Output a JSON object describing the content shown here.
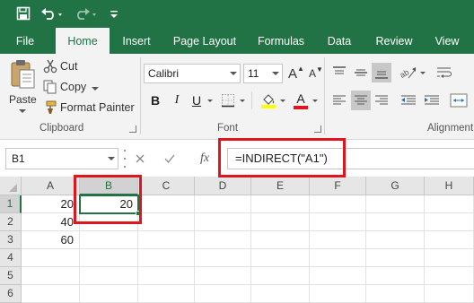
{
  "app": {
    "theme_color": "#217346",
    "highlight_color": "#e0161e"
  },
  "quick_access": {
    "save_icon": "save-icon",
    "undo_icon": "undo-icon",
    "redo_icon": "redo-icon",
    "customize_icon": "customize-qat-icon"
  },
  "tabs": [
    {
      "label": "File",
      "active": false
    },
    {
      "label": "Home",
      "active": true
    },
    {
      "label": "Insert",
      "active": false
    },
    {
      "label": "Page Layout",
      "active": false
    },
    {
      "label": "Formulas",
      "active": false
    },
    {
      "label": "Data",
      "active": false
    },
    {
      "label": "Review",
      "active": false
    },
    {
      "label": "View",
      "active": false
    }
  ],
  "ribbon": {
    "clipboard": {
      "paste_label": "Paste",
      "cut_label": "Cut",
      "copy_label": "Copy",
      "format_painter_label": "Format Painter",
      "group_label": "Clipboard"
    },
    "font": {
      "font_name": "Calibri",
      "font_size": "11",
      "bold_label": "B",
      "italic_label": "I",
      "underline_label": "U",
      "grow_label": "A",
      "shrink_label": "A",
      "font_color_label": "A",
      "group_label": "Font",
      "fill_color": "#ffff00",
      "font_color": "#e0161e"
    },
    "alignment": {
      "group_label": "Alignment"
    }
  },
  "formula_bar": {
    "name_box": "B1",
    "cancel_icon": "cancel-icon",
    "enter_icon": "enter-icon",
    "fx_label": "fx",
    "formula": "=INDIRECT(\"A1\")"
  },
  "sheet": {
    "columns": [
      "A",
      "B",
      "C",
      "D",
      "E",
      "F",
      "G",
      "H"
    ],
    "rows": [
      "1",
      "2",
      "3",
      "4",
      "5",
      "6"
    ],
    "selected_cell": "B1",
    "cells": {
      "A1": "20",
      "B1": "20",
      "A2": "40",
      "A3": "60"
    }
  }
}
